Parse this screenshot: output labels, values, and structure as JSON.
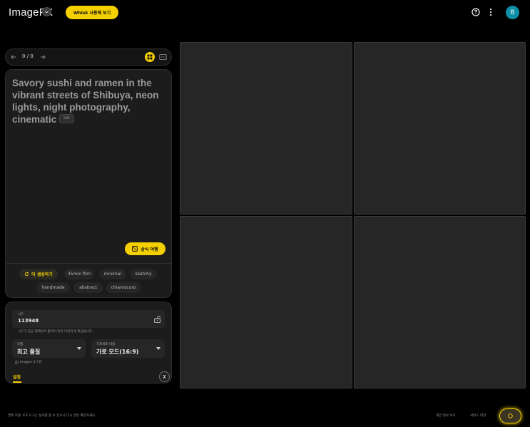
{
  "header": {
    "logo": "ImageFX",
    "whisk_button": "Whisk 사용해 보기",
    "avatar_initial": "B"
  },
  "nav": {
    "counter": "0 / 0"
  },
  "prompt": {
    "text": "Savory sushi and ramen in the vibrant streets of Shibuya, neon lights, night photography, cinematic",
    "tab_hint": "tab",
    "surprise_button": "상식 여행"
  },
  "chips": {
    "regenerate": "더 생성하기",
    "items": [
      "35mm film",
      "minimal",
      "sketchy",
      "handmade",
      "abstract",
      "chiaroscuro"
    ]
  },
  "settings": {
    "seed_label": "시드",
    "seed_value": "113948",
    "seed_hint": "시드가 잠금 해제되어 출력이 더욱 다양하게 제공됩니다.",
    "model_label": "모델",
    "model_value": "최고 품질",
    "aspect_label": "가로세로 비율",
    "aspect_value": "가로 모드(16:9)",
    "model_note": "Imagen 3 기반",
    "tab_label": "설정"
  },
  "footer": {
    "note": "면책 조항: IFX 도구는 실수를 할 수 있으니 다시 한번 확인하세요.",
    "privacy": "개인 정보 보호",
    "terms": "서비스 약관"
  },
  "colors": {
    "accent": "#f5d000",
    "background": "#000000",
    "panel": "#1c1c1c",
    "tile": "#262626",
    "avatar": "#0e8fa8"
  },
  "icons": [
    "chevron-down-icon",
    "help-icon",
    "more-vert-icon",
    "arrow-left-icon",
    "arrow-right-icon",
    "grid-view-icon",
    "single-view-icon",
    "dice-icon",
    "refresh-icon",
    "lock-open-icon",
    "info-icon",
    "collapse-icon",
    "spark-icon"
  ]
}
